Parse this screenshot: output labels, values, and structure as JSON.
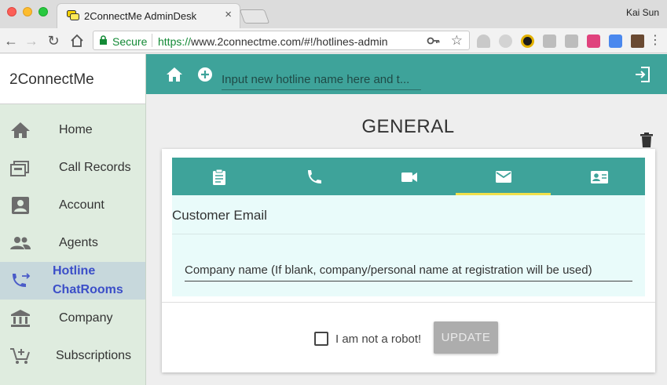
{
  "browser": {
    "tab_title": "2ConnectMe AdminDesk",
    "tab_close": "×",
    "profile_name": "Kai Sun",
    "secure_label": "Secure",
    "url_scheme": "https://",
    "url_rest": "www.2connectme.com/#!/hotlines-admin"
  },
  "sidebar": {
    "brand": "2ConnectMe",
    "items": [
      {
        "label": "Home",
        "icon": "home-icon"
      },
      {
        "label": "Call Records",
        "icon": "archive-icon"
      },
      {
        "label": "Account",
        "icon": "account-box-icon"
      },
      {
        "label": "Agents",
        "icon": "people-icon"
      },
      {
        "label_line1": "Hotline",
        "label_line2": "ChatRooms",
        "icon": "phone-forward-icon",
        "active": true
      },
      {
        "label": "Company",
        "icon": "bank-icon"
      },
      {
        "label": "Subscriptions",
        "icon": "cart-plus-icon"
      }
    ]
  },
  "topbar": {
    "hotline_placeholder": "Input new hotline name here and t..."
  },
  "main": {
    "title": "GENERAL",
    "tabs": [
      "clipboard-icon",
      "phone-icon",
      "videocam-icon",
      "email-icon",
      "contact-card-icon"
    ],
    "active_tab": 3,
    "panel_title": "Customer Email",
    "company_placeholder": "Company name (If blank, company/personal name at registration will be used)",
    "robot_label": "I am not a robot!",
    "update_label": "UPDATE"
  },
  "colors": {
    "teal": "#3ea39a",
    "sidebar_bg": "#dfecdf",
    "active_tab_indicator": "#f0e04a",
    "active_nav_text": "#3b4ec8",
    "panel_bg": "#e9fbfa"
  }
}
